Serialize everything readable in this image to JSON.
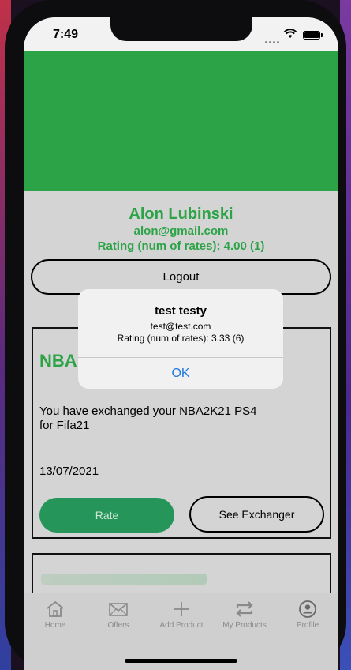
{
  "status": {
    "time": "7:49"
  },
  "colors": {
    "brand_green": "#2ba346",
    "button_green": "#25955a",
    "link_blue": "#1f7ae0"
  },
  "profile": {
    "name": "Alon Lubinski",
    "email": "alon@gmail.com",
    "rating": "Rating (num of rates): 4.00 (1)",
    "logout_label": "Logout"
  },
  "card": {
    "title": "NBA",
    "description": "You have exchanged your NBA2K21 PS4 for Fifa21",
    "date": "13/07/2021",
    "rate_label": "Rate",
    "see_label": "See Exchanger"
  },
  "alert": {
    "title": "test testy",
    "email": "test@test.com",
    "rating": "Rating (num of rates): 3.33 (6)",
    "ok_label": "OK"
  },
  "tabs": [
    {
      "label": "Home",
      "icon": "home-icon"
    },
    {
      "label": "Offers",
      "icon": "envelope-icon"
    },
    {
      "label": "Add Product",
      "icon": "plus-icon"
    },
    {
      "label": "My Products",
      "icon": "exchange-icon"
    },
    {
      "label": "Profile",
      "icon": "profile-icon"
    }
  ]
}
